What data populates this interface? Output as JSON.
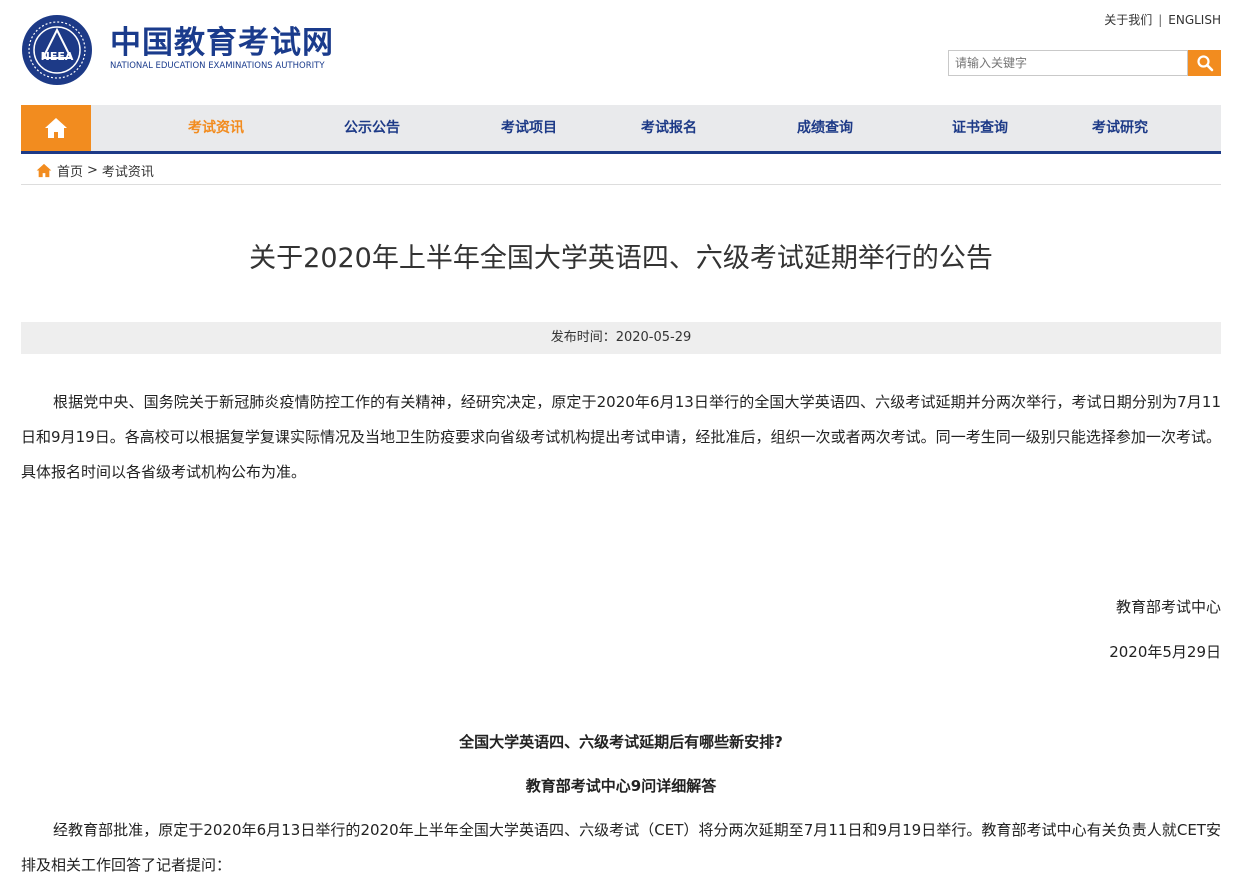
{
  "header": {
    "logo_cn": "中国教育考试网",
    "logo_en": "NATIONAL EDUCATION EXAMINATIONS AUTHORITY",
    "emblem_text": "NEEA",
    "top_links": {
      "about": "关于我们",
      "separator": "|",
      "english": "ENGLISH"
    },
    "search_placeholder": "请输入关键字",
    "brand_color": "#1d3a87",
    "accent_color": "#f28c1f"
  },
  "nav": {
    "home_icon": "home-icon",
    "items": [
      {
        "label": "考试资讯",
        "active": true
      },
      {
        "label": "公示公告"
      },
      {
        "label": "考试项目"
      },
      {
        "label": "考试报名"
      },
      {
        "label": "成绩查询"
      },
      {
        "label": "证书查询"
      },
      {
        "label": "考试研究"
      }
    ]
  },
  "breadcrumb": {
    "home": "首页",
    "sep": ">",
    "current": "考试资讯"
  },
  "article": {
    "title": "关于2020年上半年全国大学英语四、六级考试延期举行的公告",
    "publish_label": "发布时间：2020-05-29",
    "body": "根据党中央、国务院关于新冠肺炎疫情防控工作的有关精神，经研究决定，原定于2020年6月13日举行的全国大学英语四、六级考试延期并分两次举行，考试日期分别为7月11日和9月19日。各高校可以根据复学复课实际情况及当地卫生防疫要求向省级考试机构提出考试申请，经批准后，组织一次或者两次考试。同一考生同一级别只能选择参加一次考试。具体报名时间以各省级考试机构公布为准。",
    "signature": "教育部考试中心",
    "sign_date": "2020年5月29日",
    "sub_heading_1": "全国大学英语四、六级考试延期后有哪些新安排?",
    "sub_heading_2": "教育部考试中心9问详细解答",
    "body2": "经教育部批准，原定于2020年6月13日举行的2020年上半年全国大学英语四、六级考试（CET）将分两次延期至7月11日和9月19日举行。教育部考试中心有关负责人就CET安排及相关工作回答了记者提问："
  }
}
